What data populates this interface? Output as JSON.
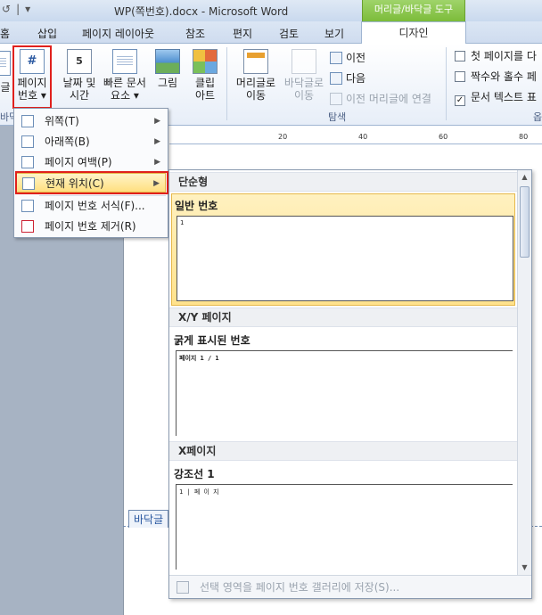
{
  "window": {
    "title": "WP(쪽번호).docx  -  Microsoft Word",
    "context_tool": "머리글/바닥글 도구",
    "qat": [
      "↺",
      "|",
      "▾"
    ]
  },
  "tabs": {
    "home": "홈",
    "insert": "삽입",
    "layout": "페이지 레이아웃",
    "references": "참조",
    "mailings": "편지",
    "review": "검토",
    "view": "보기",
    "design": "디자인"
  },
  "ribbon": {
    "cut_left": "글",
    "page_number": {
      "line1": "페이지",
      "line2": "번호 ▾"
    },
    "date_time": {
      "line1": "날짜 및",
      "line2": "시간"
    },
    "quick_parts": {
      "line1": "빠른 문서",
      "line2": "요소 ▾"
    },
    "picture": "그림",
    "clip_art": {
      "line1": "클립",
      "line2": "아트"
    },
    "goto_header": {
      "line1": "머리글로",
      "line2": "이동"
    },
    "goto_footer": {
      "line1": "바닥글로",
      "line2": "이동"
    },
    "previous": "이전",
    "next": "다음",
    "link_previous": "이전 머리글에 연결",
    "nav_group": "탐색",
    "group_left": "바닥",
    "option_first_page": "첫 페이지를 다",
    "option_odd_even": "짝수와 홀수 페",
    "option_doc_text": "문서 텍스트 표",
    "group_right": "옵"
  },
  "menu": {
    "items": [
      {
        "label": "위쪽(T)"
      },
      {
        "label": "아래쪽(B)"
      },
      {
        "label": "페이지 여백(P)"
      },
      {
        "label": "현재 위치(C)"
      },
      {
        "label": "페이지 번호 서식(F)..."
      },
      {
        "label": "페이지 번호 제거(R)"
      }
    ]
  },
  "gallery": {
    "sections": [
      {
        "heading": "단순형",
        "item_title": "일반 번호",
        "preview": "1"
      },
      {
        "heading": "X/Y 페이지",
        "item_title": "굵게 표시된 번호",
        "preview": "페이지 1 / 1"
      },
      {
        "heading": "X페이지",
        "item_title": "강조선 1",
        "preview": "1 | 페 이 지"
      }
    ],
    "footer": "선택 영역을 페이지 번호 갤러리에 저장(S)..."
  },
  "document": {
    "footer_tag": "바닥글",
    "ruler": [
      "20",
      "40",
      "60",
      "80"
    ]
  }
}
